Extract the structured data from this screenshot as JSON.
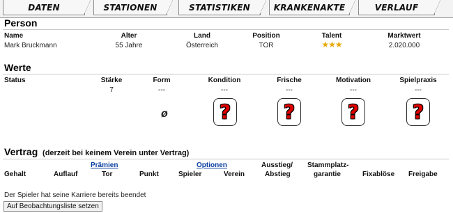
{
  "tabs": [
    "DATEN",
    "STATIONEN",
    "STATISTIKEN",
    "KRANKENAKTE",
    "VERLAUF"
  ],
  "person": {
    "title": "Person",
    "headers": {
      "name": "Name",
      "alter": "Alter",
      "land": "Land",
      "position": "Position",
      "talent": "Talent",
      "marktwert": "Marktwert"
    },
    "values": {
      "name": "Mark Bruckmann",
      "alter": "55 Jahre",
      "land": "Österreich",
      "position": "TOR",
      "talent": "★★★",
      "marktwert": "2.020.000"
    }
  },
  "werte": {
    "title": "Werte",
    "headers": {
      "status": "Status",
      "staerke": "Stärke",
      "form": "Form",
      "kondition": "Kondition",
      "frische": "Frische",
      "motivation": "Motivation",
      "spielpraxis": "Spielpraxis"
    },
    "values": {
      "staerke": "7",
      "form": "---",
      "kondition": "---",
      "frische": "---",
      "motivation": "---",
      "spielpraxis": "---"
    },
    "form_symbol": "ø",
    "unknown_symbol": "?"
  },
  "vertrag": {
    "title": "Vertrag",
    "subtitle": "(derzeit bei keinem Verein unter Vertrag)",
    "group_praemien": "Prämien",
    "group_optionen": "Optionen",
    "headers": {
      "gehalt": "Gehalt",
      "auflauf": "Auflauf",
      "tor": "Tor",
      "punkt": "Punkt",
      "spieler": "Spieler",
      "verein": "Verein",
      "ausstieg_1": "Ausstieg/",
      "ausstieg_2": "Abstieg",
      "stammplatz_1": "Stammplatz-",
      "stammplatz_2": "garantie",
      "fixabloese": "Fixablöse",
      "freigabe": "Freigabe"
    }
  },
  "note": "Der Spieler hat seine Karriere bereits beendet",
  "watchlist_button": "Auf Beobachtungsliste setzen"
}
